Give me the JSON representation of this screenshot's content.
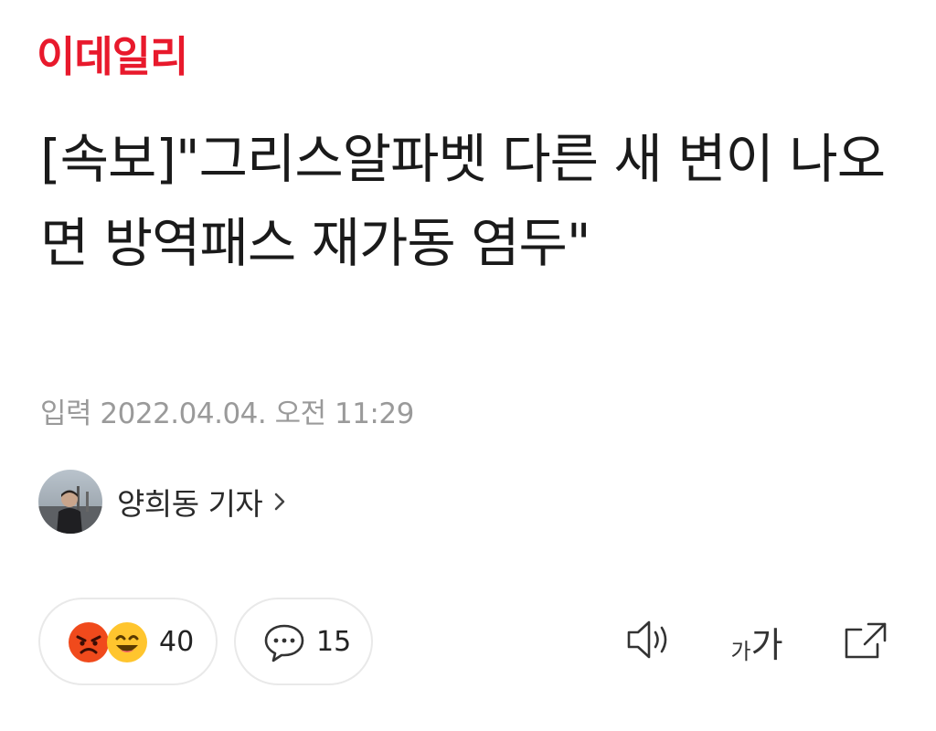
{
  "header": {
    "logo_text": "이데일리",
    "brand_color": "#e8192c"
  },
  "article": {
    "headline": "[속보]\"그리스알파벳 다른 새 변이 나오면 방역패스 재가동 염두\"",
    "published_label": "입력 2022.04.04. 오전 11:29"
  },
  "reporter": {
    "name": "양희동 기자",
    "chevron_icon": "chevron-right-icon"
  },
  "reactions": {
    "count": "40",
    "icons": [
      "angry-emoji-icon",
      "laughing-emoji-icon"
    ]
  },
  "comments": {
    "count": "15",
    "icon": "speech-bubble-icon"
  },
  "toolbar": {
    "listen_icon": "speaker-icon",
    "font_small": "가",
    "font_large": "가",
    "share_icon": "share-icon"
  }
}
